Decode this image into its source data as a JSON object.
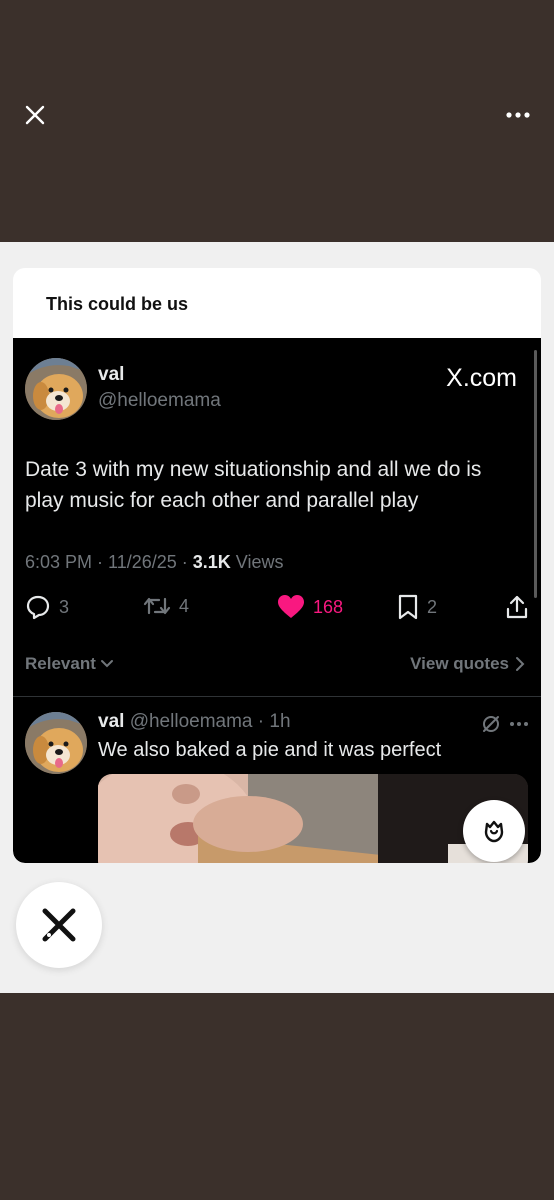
{
  "card": {
    "title": "This could be us"
  },
  "tweet": {
    "name": "val",
    "handle": "@helloemama",
    "brand": "X.com",
    "text": "Date 3 with my new situationship and all we do is play music for each other and parallel play",
    "time": "6:03 PM · 11/26/25 · ",
    "views_count": "3.1K",
    "views_label": " Views",
    "replies": "3",
    "reposts": "4",
    "likes": "168",
    "bookmarks": "2",
    "relevant_label": "Relevant",
    "view_quotes_label": "View quotes"
  },
  "reply": {
    "name": "val",
    "handle": "@helloemama",
    "time": " · 1h",
    "text": "We also baked a pie and it was perfect"
  },
  "colors": {
    "like": "#f91880",
    "bg": "#3b302b",
    "sheet": "#f0f0f0"
  }
}
